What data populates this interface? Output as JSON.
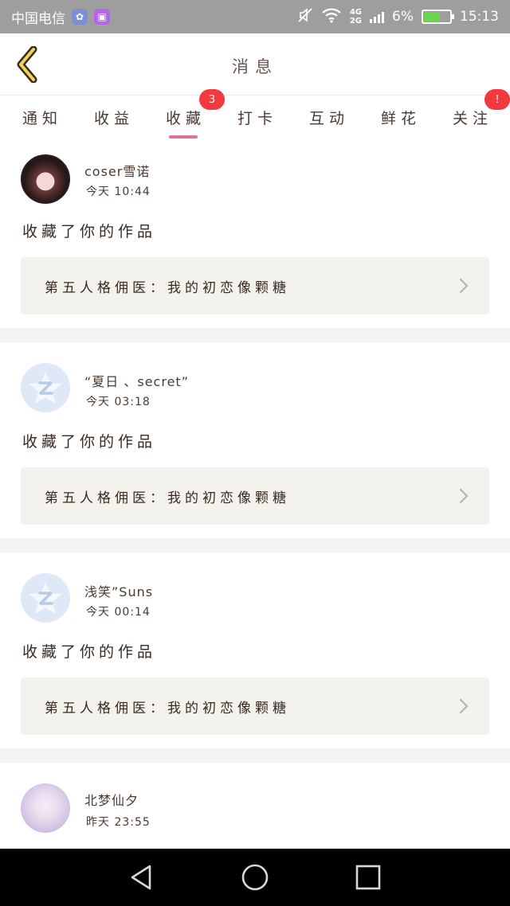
{
  "status_bar": {
    "carrier": "中国电信",
    "network_top": "4G",
    "network_bottom": "2G",
    "battery": "6%",
    "time": "15:13",
    "icons": [
      "carrier-app-icon",
      "gallery-app-icon",
      "mute-icon",
      "wifi-icon",
      "signal-icon",
      "battery-icon"
    ]
  },
  "header": {
    "title": "消息",
    "back_icon": "back-arrow-icon"
  },
  "tabs": [
    {
      "label": "通知",
      "active": false,
      "badge": ""
    },
    {
      "label": "收益",
      "active": false,
      "badge": ""
    },
    {
      "label": "收藏",
      "active": true,
      "badge": "3"
    },
    {
      "label": "打卡",
      "active": false,
      "badge": ""
    },
    {
      "label": "互动",
      "active": false,
      "badge": ""
    },
    {
      "label": "鲜花",
      "active": false,
      "badge": ""
    },
    {
      "label": "关注",
      "active": false,
      "badge": "!"
    }
  ],
  "accent_color": "#e16e9c",
  "badge_color": "#f2393d",
  "messages": [
    {
      "user": "coser雪诺",
      "time": "今天 10:44",
      "action": "收藏了你的作品",
      "work": "第五人格佣医：我的初恋像颗糖"
    },
    {
      "user": "“夏日 、secret”",
      "time": "今天 03:18",
      "action": "收藏了你的作品",
      "work": "第五人格佣医：我的初恋像颗糖"
    },
    {
      "user": "浅笑”Suns",
      "time": "今天 00:14",
      "action": "收藏了你的作品",
      "work": "第五人格佣医：我的初恋像颗糖"
    },
    {
      "user": "北梦仙夕",
      "time": "昨天 23:55"
    }
  ],
  "nav_bar": {
    "icons": [
      "back-triangle-icon",
      "home-circle-icon",
      "recents-square-icon"
    ]
  }
}
